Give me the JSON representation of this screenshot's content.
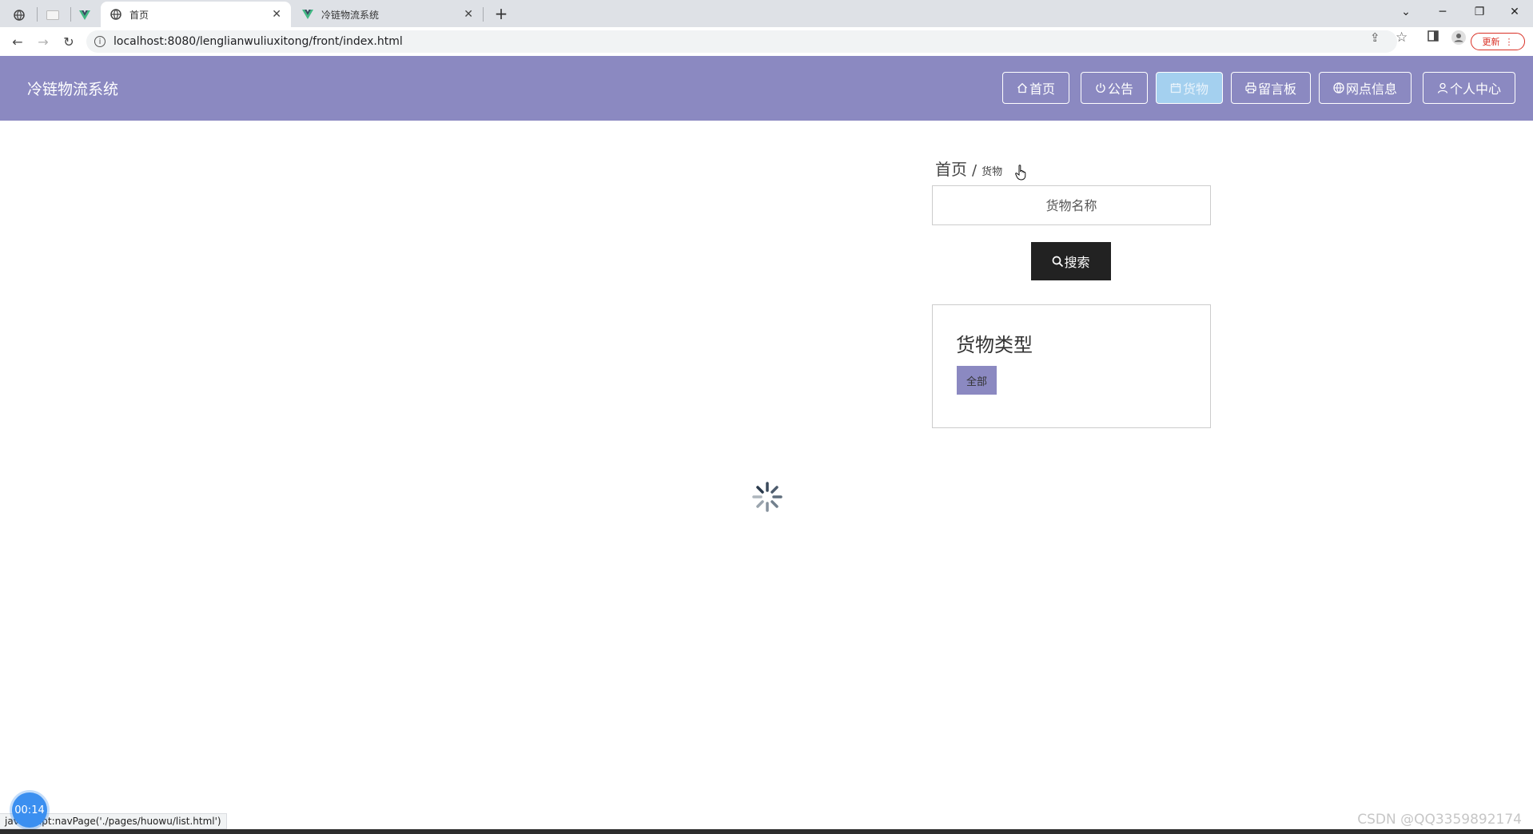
{
  "browser": {
    "tabs": [
      {
        "title": "首页",
        "active": true
      },
      {
        "title": "冷链物流系统",
        "active": false
      }
    ],
    "url": "localhost:8080/lenglianwuliuxitong/front/index.html",
    "update_label": "更新"
  },
  "header": {
    "title": "冷链物流系统",
    "nav": [
      {
        "icon": "home-icon",
        "label": "首页",
        "active": false
      },
      {
        "icon": "power-icon",
        "label": "公告",
        "active": false
      },
      {
        "icon": "calendar-icon",
        "label": "货物",
        "active": true
      },
      {
        "icon": "printer-icon",
        "label": "留言板",
        "active": false
      },
      {
        "icon": "globe-icon",
        "label": "网点信息",
        "active": false
      },
      {
        "icon": "user-icon",
        "label": "个人中心",
        "active": false
      }
    ]
  },
  "breadcrumb": {
    "home": "首页",
    "separator": "/",
    "current": "货物"
  },
  "search": {
    "placeholder": "货物名称",
    "button_label": "搜索"
  },
  "category_panel": {
    "title": "货物类型",
    "tags": [
      "全部"
    ]
  },
  "status_bar": {
    "link": "javascript:navPage('./pages/huowu/list.html')"
  },
  "overlay": {
    "timer": "00:14",
    "watermark": "CSDN @QQ3359892174"
  },
  "colors": {
    "header_bg": "#8b89c1",
    "active_nav_bg": "#a4d0ef",
    "search_button_bg": "#222222",
    "tag_bg": "#8b89c1"
  }
}
